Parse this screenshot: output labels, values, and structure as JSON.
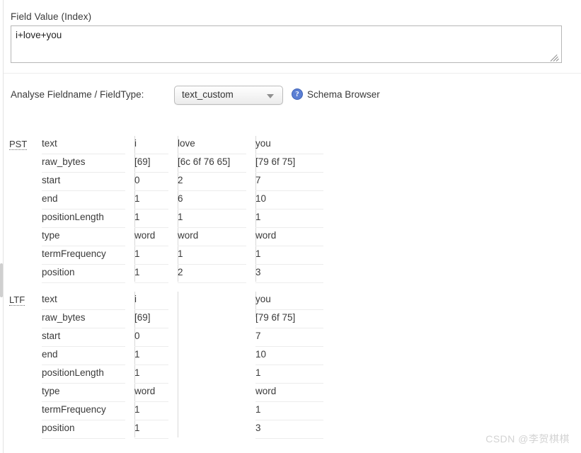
{
  "field_value": {
    "label": "Field Value (Index)",
    "value": "i+love+you",
    "placeholder": ""
  },
  "analyse": {
    "label": "Analyse Fieldname / FieldType:",
    "fieldtype_selected": "text_custom",
    "fieldtype_options": [
      "text_custom"
    ],
    "help_icon": "question-mark-icon",
    "help_glyph": "?",
    "schema_browser_label": "Schema Browser"
  },
  "analysis": {
    "keys": [
      "text",
      "raw_bytes",
      "start",
      "end",
      "positionLength",
      "type",
      "termFrequency",
      "position"
    ],
    "blocks": [
      {
        "abbr": "PST",
        "tokens": [
          {
            "text": "i",
            "raw_bytes": "[69]",
            "start": "0",
            "end": "1",
            "positionLength": "1",
            "type": "word",
            "termFrequency": "1",
            "position": "1"
          },
          {
            "text": "love",
            "raw_bytes": "[6c 6f 76 65]",
            "start": "2",
            "end": "6",
            "positionLength": "1",
            "type": "word",
            "termFrequency": "1",
            "position": "2"
          },
          {
            "text": "you",
            "raw_bytes": "[79 6f 75]",
            "start": "7",
            "end": "10",
            "positionLength": "1",
            "type": "word",
            "termFrequency": "1",
            "position": "3"
          }
        ]
      },
      {
        "abbr": "LTF",
        "tokens": [
          {
            "text": "i",
            "raw_bytes": "[69]",
            "start": "0",
            "end": "1",
            "positionLength": "1",
            "type": "word",
            "termFrequency": "1",
            "position": "1"
          },
          {
            "text": "",
            "raw_bytes": "",
            "start": "",
            "end": "",
            "positionLength": "",
            "type": "",
            "termFrequency": "",
            "position": ""
          },
          {
            "text": "you",
            "raw_bytes": "[79 6f 75]",
            "start": "7",
            "end": "10",
            "positionLength": "1",
            "type": "word",
            "termFrequency": "1",
            "position": "3"
          }
        ]
      }
    ]
  },
  "watermark": "CSDN @李贺棋棋",
  "colors": {
    "text": "#3a3a3a",
    "border": "#d9d9d9",
    "row_rule": "#ececec",
    "help_blue": "#5b7fd4",
    "watermark": "#d3d3d3"
  }
}
